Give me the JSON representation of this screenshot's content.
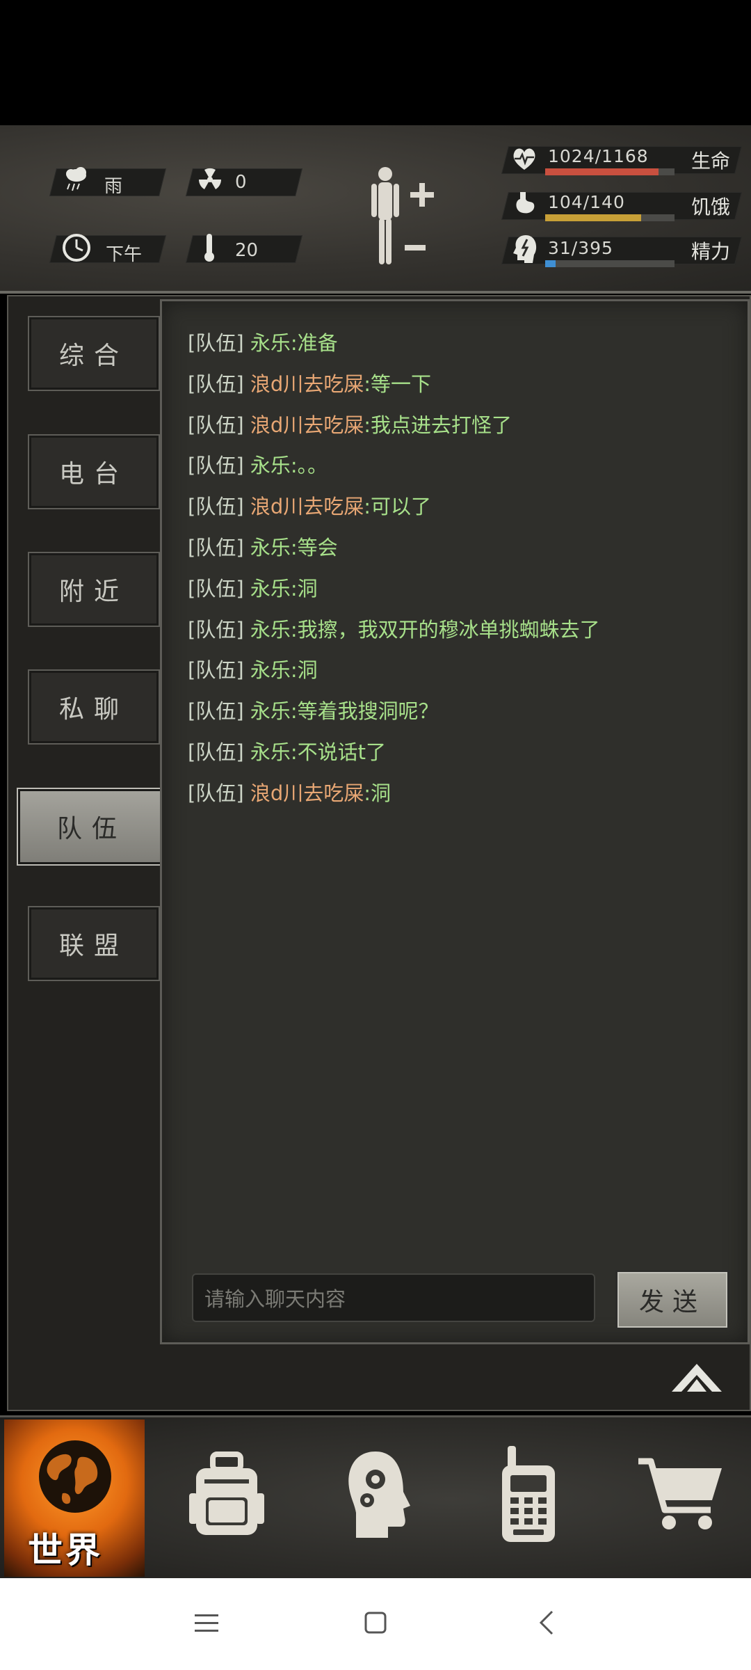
{
  "status": {
    "weather": "雨",
    "radiation": "0",
    "time_of_day": "下午",
    "temperature": "20",
    "health": {
      "text": "1024/1168",
      "label": "生命",
      "fraction": 0.877,
      "color": "#c9503f"
    },
    "hunger": {
      "text": "104/140",
      "label": "饥饿",
      "fraction": 0.743,
      "color": "#c8a037"
    },
    "energy": {
      "text": "31/395",
      "label": "精力",
      "fraction": 0.078,
      "color": "#3f8fd3"
    }
  },
  "tabs": [
    {
      "label": "综合"
    },
    {
      "label": "电台"
    },
    {
      "label": "附近"
    },
    {
      "label": "私聊"
    },
    {
      "label": "队伍",
      "active": true
    },
    {
      "label": "联盟"
    }
  ],
  "chat": {
    "messages": [
      {
        "channel": "[队伍]",
        "sender": "永乐",
        "sender_type": "me",
        "text": ":准备"
      },
      {
        "channel": "[队伍]",
        "sender": "浪d川去吃屎",
        "sender_type": "other",
        "text": ":等一下"
      },
      {
        "channel": "[队伍]",
        "sender": "浪d川去吃屎",
        "sender_type": "other",
        "text": ":我点进去打怪了"
      },
      {
        "channel": "[队伍]",
        "sender": "永乐",
        "sender_type": "me",
        "text": ":。。"
      },
      {
        "channel": "[队伍]",
        "sender": "浪d川去吃屎",
        "sender_type": "other",
        "text": ":可以了"
      },
      {
        "channel": "[队伍]",
        "sender": "永乐",
        "sender_type": "me",
        "text": ":等会"
      },
      {
        "channel": "[队伍]",
        "sender": "永乐",
        "sender_type": "me",
        "text": ":洞"
      },
      {
        "channel": "[队伍]",
        "sender": "永乐",
        "sender_type": "me",
        "text": ":我擦，我双开的穆冰单挑蜘蛛去了"
      },
      {
        "channel": "[队伍]",
        "sender": "永乐",
        "sender_type": "me",
        "text": ":洞"
      },
      {
        "channel": "[队伍]",
        "sender": "永乐",
        "sender_type": "me",
        "text": ":等着我搜洞呢？"
      },
      {
        "channel": "[队伍]",
        "sender": "永乐",
        "sender_type": "me",
        "text": ":不说话t了"
      },
      {
        "channel": "[队伍]",
        "sender": "浪d川去吃屎",
        "sender_type": "other",
        "text": ":洞"
      }
    ],
    "input_placeholder": "请输入聊天内容",
    "send_label": "发送"
  },
  "nav": {
    "world_label": "世界",
    "items": [
      "backpack-icon",
      "skills-head-icon",
      "walkie-talkie-icon",
      "shopping-cart-icon"
    ]
  }
}
